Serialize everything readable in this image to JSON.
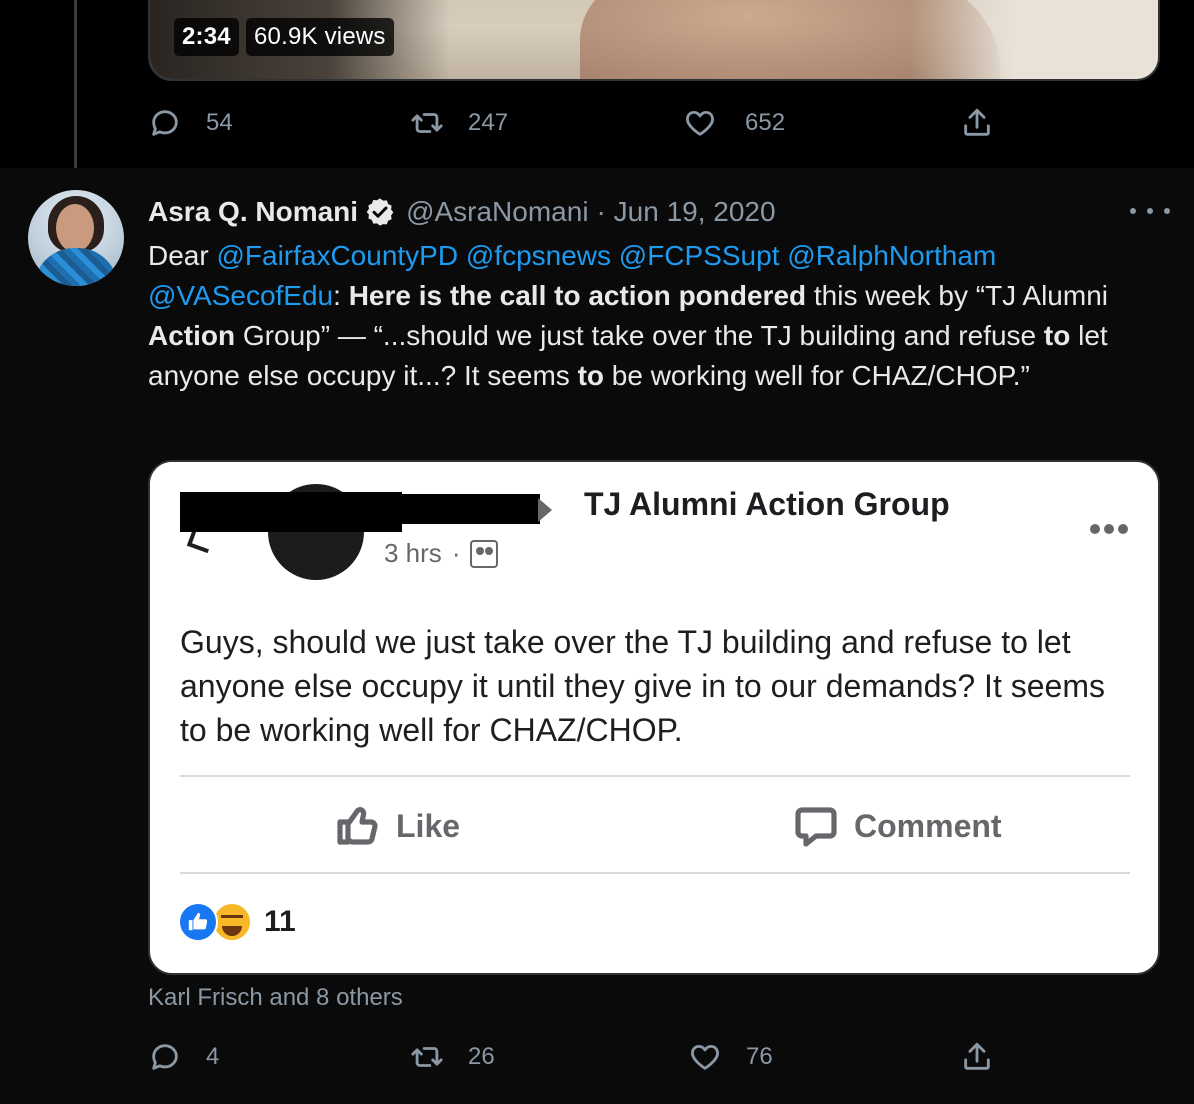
{
  "parent_tweet": {
    "video": {
      "duration": "2:34",
      "views": "60.9K views"
    },
    "actions": {
      "replies": "54",
      "retweets": "247",
      "likes": "652"
    }
  },
  "tweet": {
    "author": {
      "name": "Asra Q. Nomani",
      "handle": "@AsraNomani",
      "date": "· Jun 19, 2020"
    },
    "text": {
      "p1": "Dear ",
      "m1": "@FairfaxCountyPD",
      "m2": "@fcpsnews",
      "m3": "@FCPSSupt",
      "m4": "@RalphNortham",
      "m5": "@VASecofEdu",
      "p2": ": ",
      "b1": "Here is the call to action pondered",
      "p3": " this week by “TJ Alumni ",
      "b2": "Action",
      "p4": " Group” — “...should we just take over the TJ building and refuse ",
      "b3": "to",
      "p5": " let anyone else occupy it...? It seems ",
      "b4": "to",
      "p6": " be working well for CHAZ/CHOP.”"
    },
    "embed": {
      "group_name": "TJ Alumni Action Group",
      "time": "3 hrs",
      "dot": "·",
      "post_text": "Guys, should we just take over the TJ building and refuse to let anyone else occupy it until they give in to our demands? It seems to be working well for CHAZ/CHOP.",
      "like_label": "Like",
      "comment_label": "Comment",
      "reaction_count": "11"
    },
    "liked_by": "Karl Frisch and 8 others",
    "actions": {
      "replies": "4",
      "retweets": "26",
      "likes": "76"
    }
  }
}
